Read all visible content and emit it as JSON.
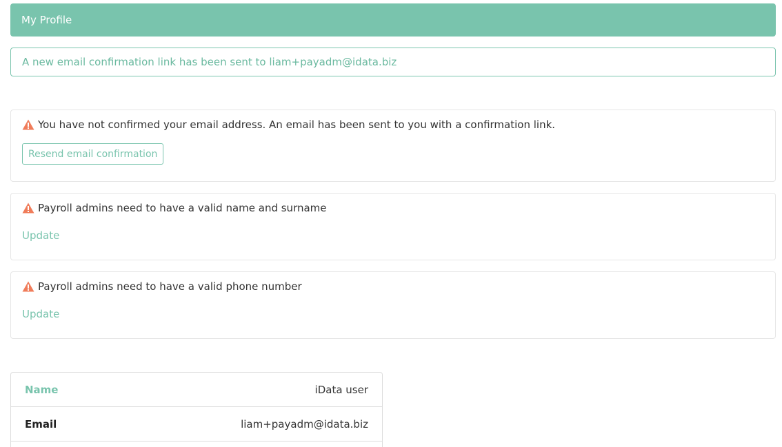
{
  "header": {
    "title": "My Profile"
  },
  "flash": {
    "message": "A new email confirmation link has been sent to liam+payadm@idata.biz"
  },
  "warnings": [
    {
      "message": "You have not confirmed your email address. An email has been sent to you with a confirmation link.",
      "action_label": "Resend email confirmation"
    },
    {
      "message": "Payroll admins need to have a valid name and surname",
      "action_label": "Update"
    },
    {
      "message": "Payroll admins need to have a valid phone number",
      "action_label": "Update"
    }
  ],
  "profile": {
    "rows": [
      {
        "label": "Name",
        "value": "iData user"
      },
      {
        "label": "Email",
        "value": "liam+payadm@idata.biz"
      }
    ]
  },
  "colors": {
    "accent": "#79c4ad",
    "warning_icon": "#f07c5a"
  },
  "icons": {
    "warning": "warning-triangle-icon"
  }
}
